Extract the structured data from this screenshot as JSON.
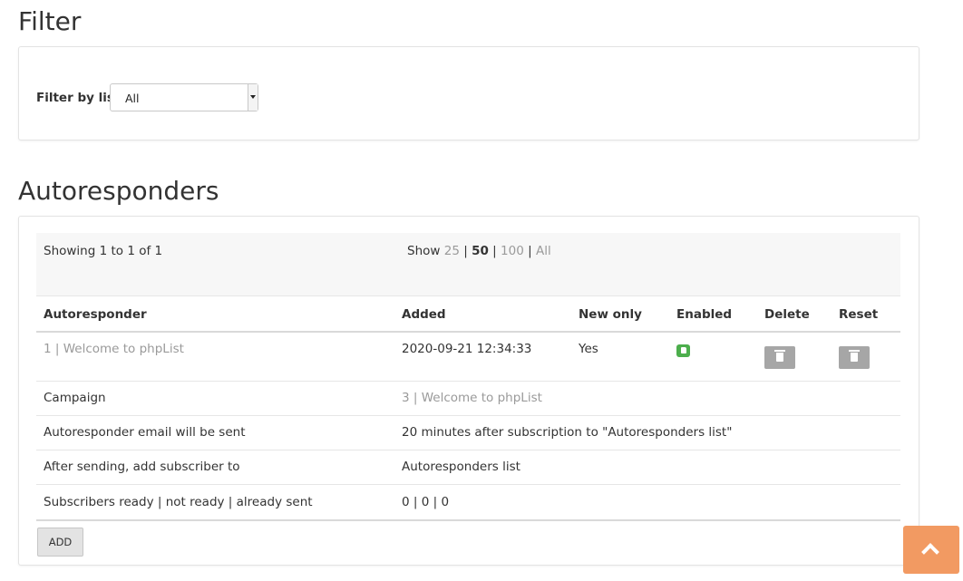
{
  "filter": {
    "title": "Filter",
    "label": "Filter by list",
    "selected": "All"
  },
  "autoresponders": {
    "title": "Autoresponders",
    "showing": "Showing 1 to 1 of 1",
    "show_label": "Show",
    "show_options": [
      "25",
      "50",
      "100",
      "All"
    ],
    "show_active": "50",
    "columns": {
      "autoresponder": "Autoresponder",
      "added": "Added",
      "new_only": "New only",
      "enabled": "Enabled",
      "delete": "Delete",
      "reset": "Reset"
    },
    "row": {
      "autoresponder": "1 | Welcome to phpList",
      "added": "2020-09-21 12:34:33",
      "new_only": "Yes",
      "enabled_icon": "thumbs-up-icon",
      "delete_icon": "trash-icon",
      "reset_icon": "trash-icon"
    },
    "details": [
      {
        "label": "Campaign",
        "value": "3 | Welcome to phpList"
      },
      {
        "label": "Autoresponder email will be sent",
        "value": "20 minutes after subscription to \"Autoresponders list\""
      },
      {
        "label": "After sending, add subscriber to",
        "value": "Autoresponders list"
      },
      {
        "label": "Subscribers ready | not ready | already sent",
        "value": "0 | 0 | 0"
      }
    ],
    "add_label": "ADD"
  },
  "colors": {
    "accent": "#f29a62",
    "enabled": "#4cae4c",
    "icon_button": "#a6a6a6"
  }
}
